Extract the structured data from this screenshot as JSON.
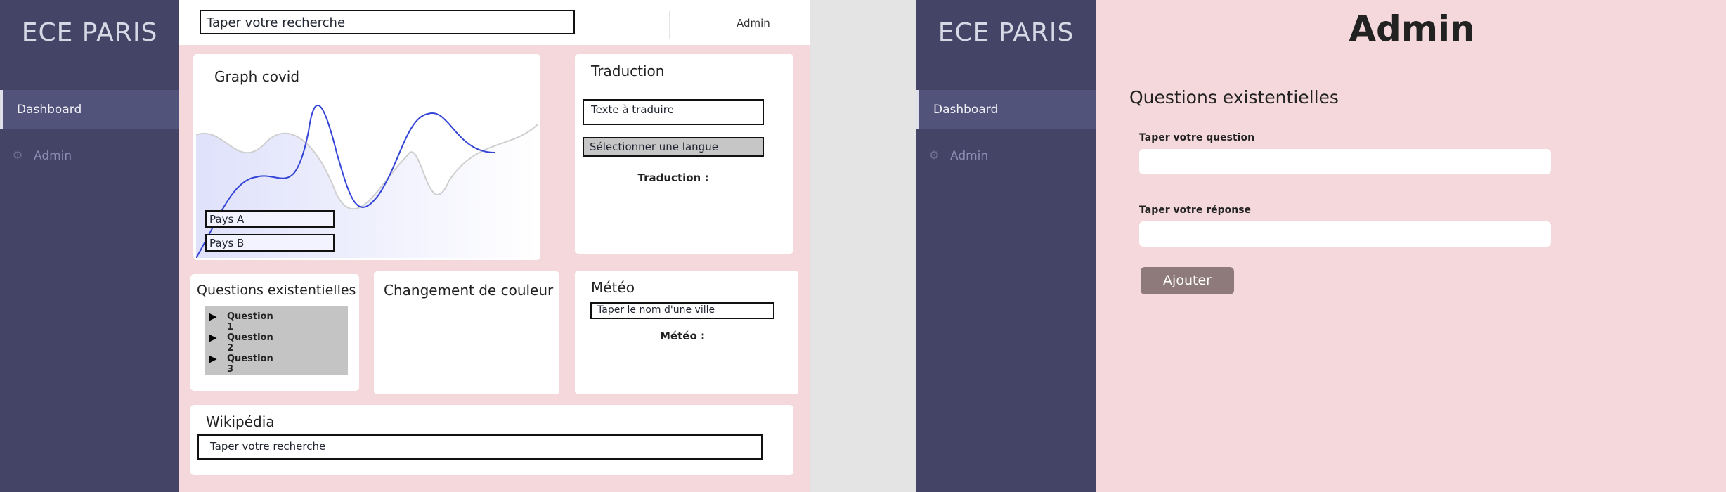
{
  "dashboard": {
    "brand": "ECE PARIS",
    "nav": {
      "dashboard": "Dashboard",
      "admin": "Admin"
    },
    "topbar": {
      "search_value": "Taper votre recherche",
      "admin_link": "Admin"
    },
    "graph": {
      "title": "Graph covid",
      "country_a": "Pays A",
      "country_b": "Pays B"
    },
    "translation": {
      "title": "Traduction",
      "text_value": "Texte à traduire",
      "language_select": "Sélectionner une langue",
      "result_label": "Traduction :"
    },
    "questions": {
      "title": "Questions existentielles",
      "items": [
        "Question 1",
        "Question 2",
        "Question 3"
      ]
    },
    "color_change": {
      "title": "Changement de couleur"
    },
    "weather": {
      "title": "Météo",
      "city_value": "Taper le nom d'une ville",
      "result_label": "Météo :"
    },
    "wikipedia": {
      "title": "Wikipédia",
      "search_value": "Taper votre recherche"
    }
  },
  "admin_page": {
    "brand": "ECE PARIS",
    "nav": {
      "dashboard": "Dashboard",
      "admin": "Admin"
    },
    "title": "Admin",
    "section_title": "Questions existentielles",
    "question_label": "Taper votre question",
    "answer_label": "Taper votre réponse",
    "add_button": "Ajouter"
  },
  "colors": {
    "sidebar": "#434466",
    "main_bg": "#f4d8db",
    "line_primary": "#3344d6",
    "line_secondary": "#cfcfcf",
    "button": "#8e7a7a"
  }
}
